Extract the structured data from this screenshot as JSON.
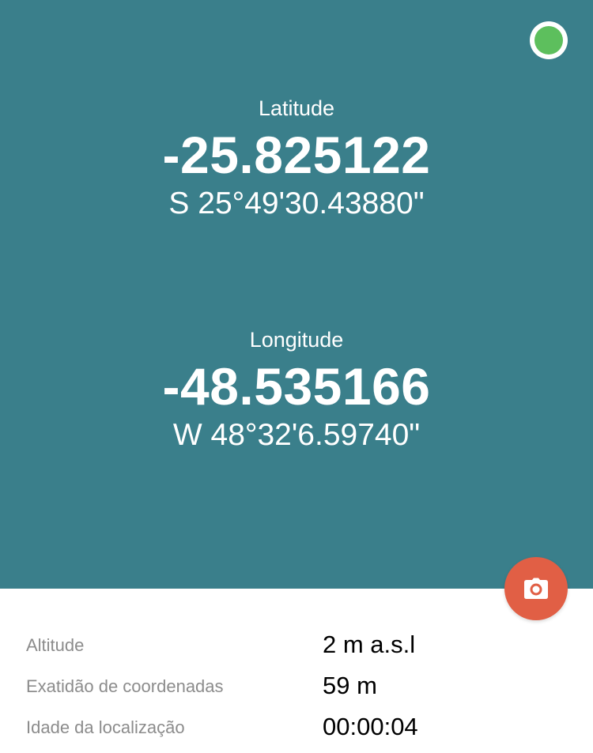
{
  "status": {
    "icon": "gps-status-indicator",
    "color": "#5dbf5d"
  },
  "latitude": {
    "label": "Latitude",
    "decimal": "-25.825122",
    "dms": "S 25°49'30.43880\""
  },
  "longitude": {
    "label": "Longitude",
    "decimal": "-48.535166",
    "dms": "W 48°32'6.59740\""
  },
  "camera_button": {
    "icon": "camera-icon",
    "color": "#e15f45"
  },
  "info": {
    "rows": [
      {
        "label": "Altitude",
        "value": "2 m a.s.l"
      },
      {
        "label": "Exatidão de coordenadas",
        "value": "59 m"
      },
      {
        "label": "Idade da localização",
        "value": "00:00:04"
      }
    ]
  },
  "colors": {
    "panel_background": "#3a7f8b",
    "label_gray": "#8c8c8c"
  }
}
